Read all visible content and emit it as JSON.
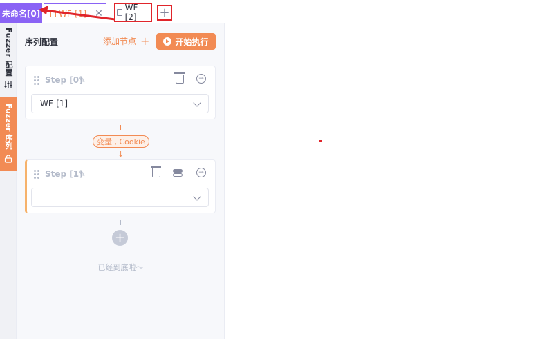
{
  "tabs": {
    "active_label": "未命名[0]",
    "wf1_label": "WF-[1]",
    "wf2_label": "WF-[2]",
    "add_symbol": "+",
    "close_symbol": "✕"
  },
  "sidenav": {
    "config_label": "Fuzzer 配置",
    "sequence_label": "Fuzzer 序列"
  },
  "panel": {
    "title": "序列配置",
    "add_node_label": "添加节点",
    "run_label": "开始执行"
  },
  "steps": [
    {
      "label": "Step [0]",
      "selected_value": "WF-[1]"
    },
    {
      "label": "Step [1]",
      "selected_value": ""
    }
  ],
  "connector": {
    "tag": "变量 , Cookie"
  },
  "footer": {
    "text": "已经到底啦～"
  },
  "colors": {
    "accent_purple": "#8a63f5",
    "accent_orange": "#f28b54",
    "highlight_red": "#e0252b"
  },
  "icons": [
    "file-icon",
    "close-icon",
    "plus-icon",
    "settings-icon",
    "lock-icon",
    "drag-handle-icon",
    "edit-icon",
    "trash-icon",
    "toggle-icon",
    "goto-icon",
    "chevron-down-icon",
    "play-icon"
  ]
}
